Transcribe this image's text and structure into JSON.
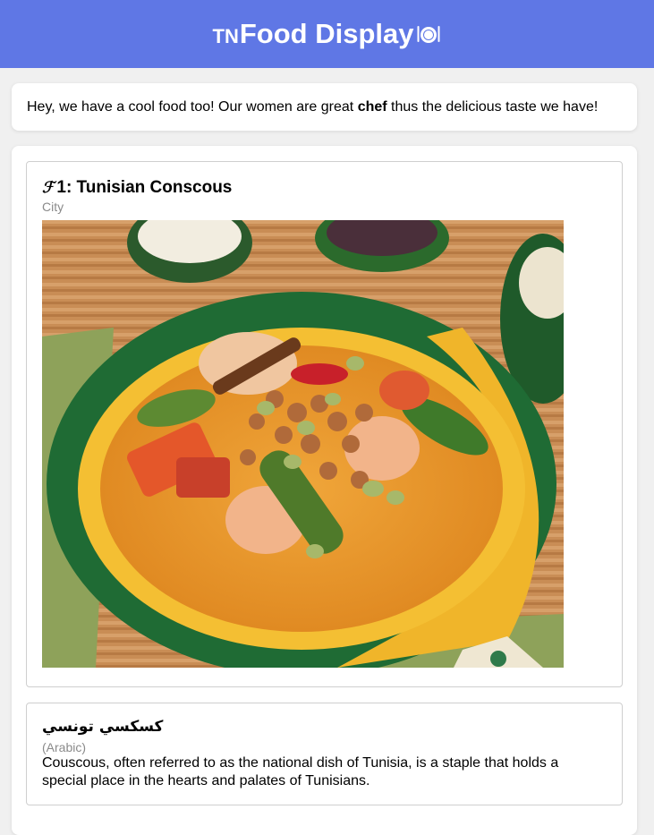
{
  "header": {
    "flag_mark": "TN",
    "title": "Food Display",
    "plate_icon": "plate-cutlery-icon"
  },
  "intro": {
    "text_before": "Hey, we have a cool food too! Our women are great ",
    "bold_word": "chef",
    "text_after": " thus the delicious taste we have!"
  },
  "dish": {
    "number_label": "1: Tunisian Conscous",
    "title_icon": "script-f-icon",
    "title_glyph": "ℱ",
    "subtitle": "City",
    "image_alt": "tunisian-couscous-dish-image"
  },
  "info": {
    "arabic_name": "كسكسي تونسي",
    "language": "(Arabic)",
    "description": "Couscous, often referred to as the national dish of Tunisia, is a staple that holds a special place in the hearts and palates of Tunisians."
  },
  "colors": {
    "header_bg": "#5f77e5",
    "page_bg": "#f0f0f0",
    "card_bg": "#ffffff",
    "muted_text": "#8a8a8a"
  }
}
